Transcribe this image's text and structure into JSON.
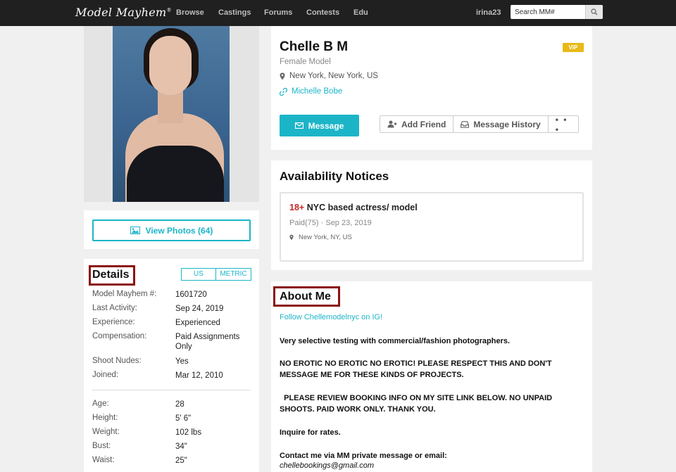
{
  "nav": {
    "logo": "Model Mayhem",
    "links": [
      "Browse",
      "Castings",
      "Forums",
      "Contests",
      "Edu"
    ],
    "user": "irina23",
    "search_placeholder": "Search MM#"
  },
  "profile": {
    "name": "Chelle B M",
    "badge": "VIP",
    "type": "Female Model",
    "location": "New York, New York, US",
    "link_text": "Michelle Bobe",
    "buttons": {
      "message": "Message",
      "add_friend": "Add Friend",
      "message_history": "Message History",
      "more": "• • •"
    }
  },
  "photos": {
    "view_button": "View Photos (64)"
  },
  "details": {
    "title": "Details",
    "units": [
      "US",
      "METRIC"
    ],
    "rows": [
      {
        "label": "Model Mayhem #:",
        "value": "1601720"
      },
      {
        "label": "Last Activity:",
        "value": "Sep 24, 2019"
      },
      {
        "label": "Experience:",
        "value": "Experienced"
      },
      {
        "label": "Compensation:",
        "value": "Paid Assignments Only"
      },
      {
        "label": "Shoot Nudes:",
        "value": "Yes"
      },
      {
        "label": "Joined:",
        "value": "Mar 12, 2010"
      }
    ],
    "stats": [
      {
        "label": "Age:",
        "value": "28"
      },
      {
        "label": "Height:",
        "value": "5' 6\""
      },
      {
        "label": "Weight:",
        "value": "102 lbs"
      },
      {
        "label": "Bust:",
        "value": "34\""
      },
      {
        "label": "Waist:",
        "value": "25\""
      }
    ]
  },
  "availability": {
    "title": "Availability Notices",
    "notice": {
      "age": "18+",
      "title": "NYC based actress/ model",
      "meta": "Paid(75) · Sep 23, 2019",
      "location": "New York, NY, US"
    }
  },
  "about": {
    "title": "About Me",
    "link": "Follow Chellemodelnyc on IG!",
    "p1": "Very selective testing with commercial/fashion photographers.",
    "p2": "NO EROTIC NO EROTIC NO EROTIC! PLEASE RESPECT THIS AND DON'T MESSAGE ME FOR THESE KINDS OF PROJECTS.",
    "p3": "  PLEASE REVIEW BOOKING INFO ON MY SITE LINK BELOW. NO UNPAID SHOOTS. PAID WORK ONLY. THANK YOU.",
    "p4": "Inquire for rates.",
    "p5": "Contact me via MM private message or email:",
    "email": "chellebookings@gmail.com"
  },
  "colors": {
    "accent": "#1cb5c8",
    "vip": "#e8b918",
    "highlight_box": "#8b1212",
    "age_red": "#c62828",
    "nav_bg": "#202020"
  }
}
